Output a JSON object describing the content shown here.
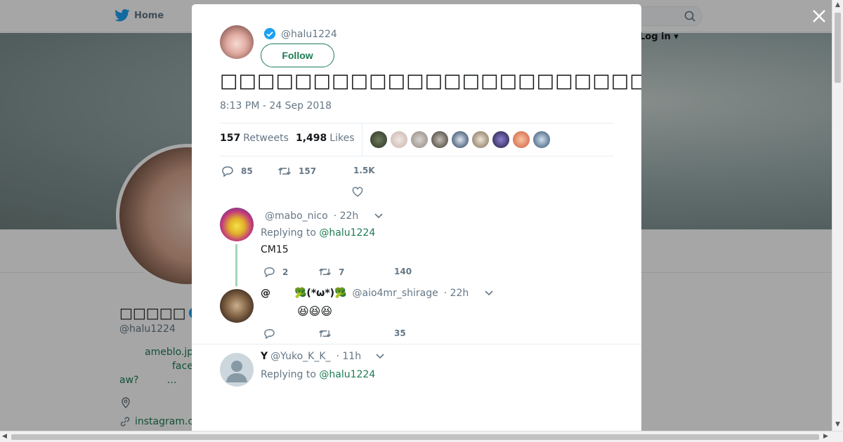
{
  "background": {
    "home_label": "Home",
    "login_label": "Log in",
    "profile_name": "□□□□□",
    "profile_handle": "@halu1224",
    "bio_line1": "ameblo.jp",
    "bio_line2": "face",
    "bio_line3": "aw?",
    "bio_line3_ellipsis": "…",
    "url_text": "instagram.c"
  },
  "tweet": {
    "handle": "@halu1224",
    "follow_label": "Follow",
    "text": "□□□□□□□□□□□□□□□□□□□□□□□□□□□□□□□□□□□□□□□□□□□□□□",
    "timestamp": "8:13 PM - 24 Sep 2018",
    "retweets_count": "157",
    "retweets_label": "Retweets",
    "likes_count": "1,498",
    "likes_label": "Likes",
    "reply_count": "85",
    "retweet_count_short": "157",
    "like_count_short": "1.5K"
  },
  "replies": [
    {
      "handle": "@mabo_nico",
      "time": "· 22h",
      "replying_prefix": "Replying to",
      "replying_to": "@halu1224",
      "text": "CM15",
      "reply_count": "2",
      "retweet_count": "7",
      "like_count": "140"
    },
    {
      "name": "@",
      "name_suffix": "🥦(*ω*)🥦",
      "handle": "@aio4mr_shirage",
      "time": "· 22h",
      "text": "😆😆😆",
      "like_count": "35"
    },
    {
      "name": "Y",
      "handle": "@Yuko_K_K_",
      "time": "· 11h",
      "replying_prefix": "Replying to",
      "replying_to": "@halu1224"
    }
  ],
  "colors": {
    "accent": "#1c7c54",
    "muted": "#657786",
    "twitter_blue": "#1da1f2"
  }
}
